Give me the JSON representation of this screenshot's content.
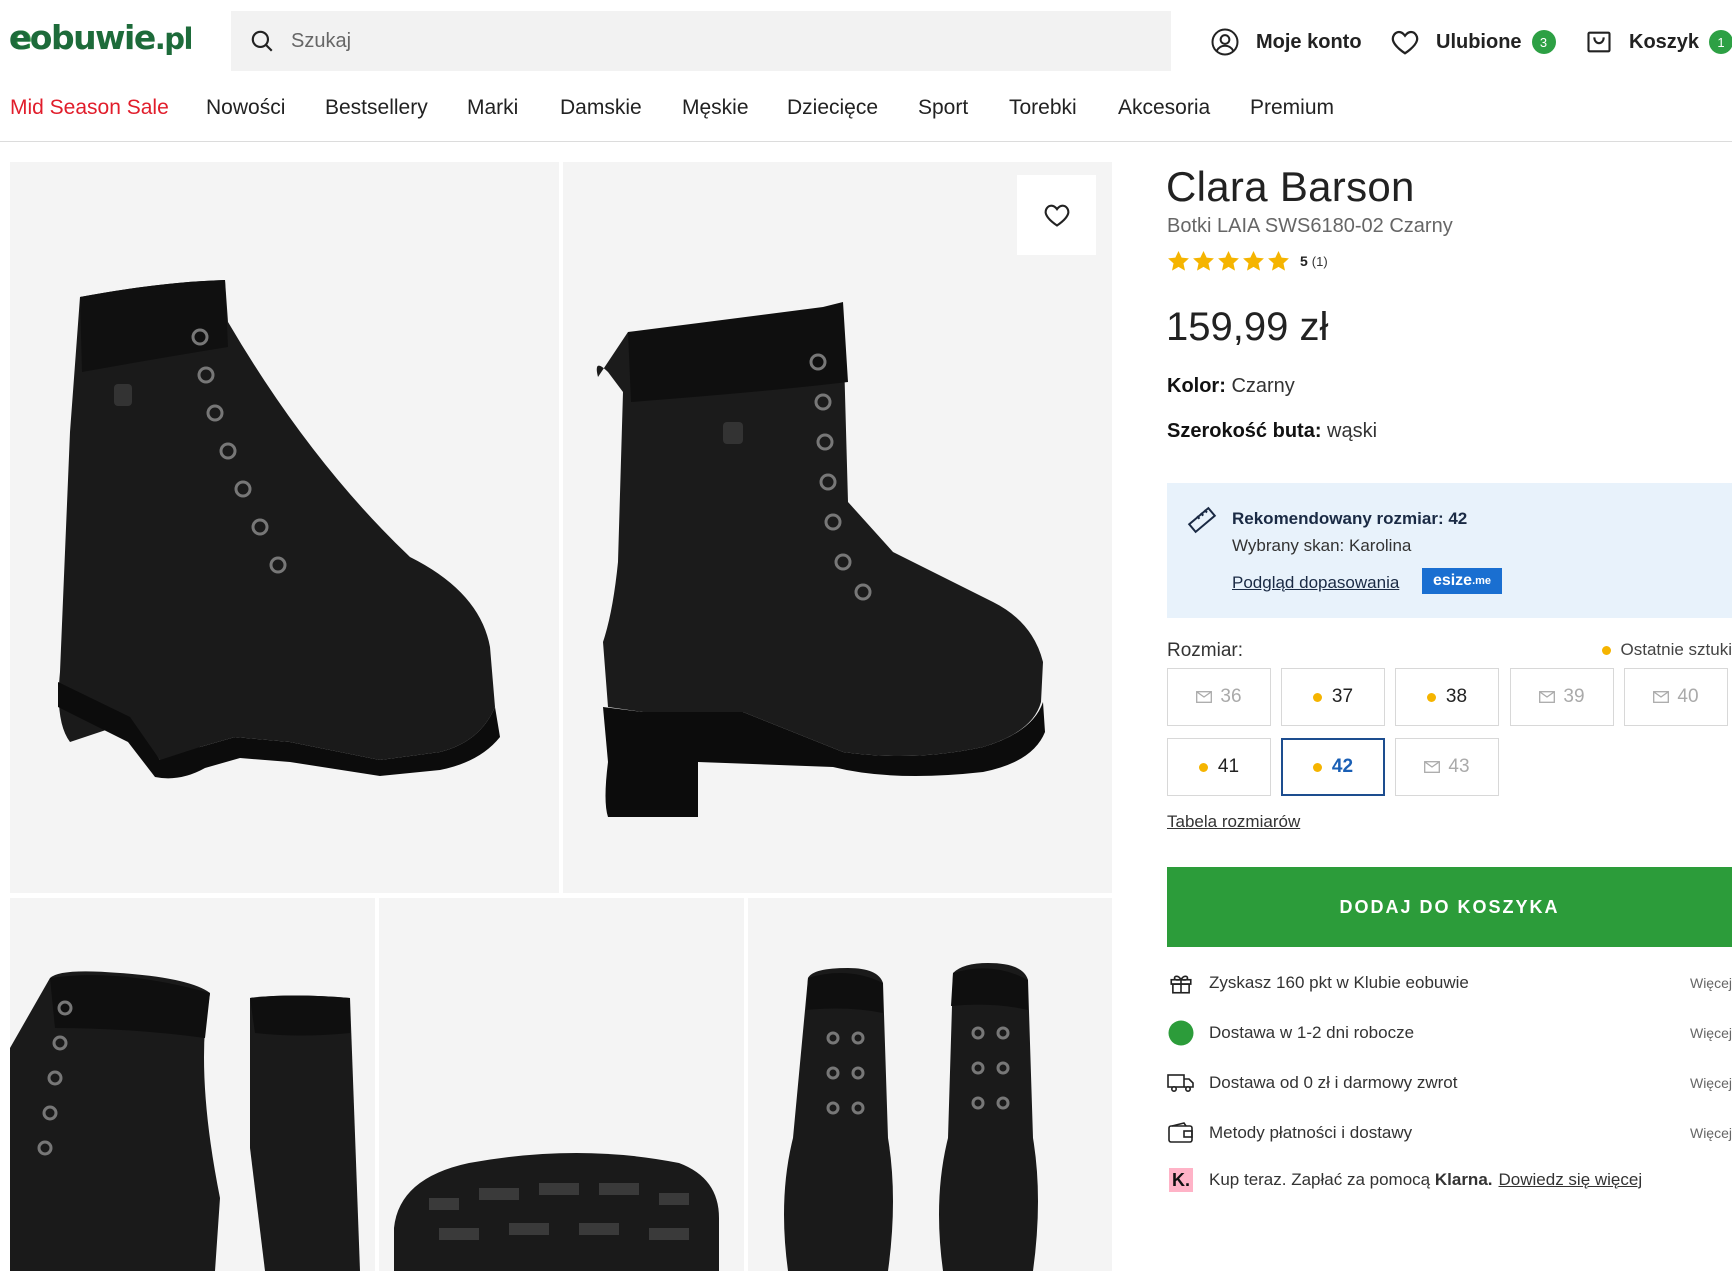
{
  "header": {
    "logo_main": "eobuwie",
    "logo_tld": ".pl",
    "search_placeholder": "Szukaj",
    "account_label": "Moje konto",
    "favorites_label": "Ulubione",
    "favorites_count": "3",
    "cart_label": "Koszyk",
    "cart_count": "1"
  },
  "nav": {
    "items": [
      "Mid Season Sale",
      "Nowości",
      "Bestsellery",
      "Marki",
      "Damskie",
      "Męskie",
      "Dziecięce",
      "Sport",
      "Torebki",
      "Akcesoria",
      "Premium"
    ]
  },
  "product": {
    "brand": "Clara Barson",
    "name": "Botki LAIA SWS6180-02 Czarny",
    "rating_value": "5",
    "rating_count": "(1)",
    "rating_stars": 5,
    "price": "159,99 zł",
    "color_label": "Kolor:",
    "color_value": "Czarny",
    "width_label": "Szerokość buta:",
    "width_value": "wąski"
  },
  "recommendation": {
    "title": "Rekomendowany rozmiar: 42",
    "scan": "Wybrany skan: Karolina",
    "link": "Podgląd dopasowania",
    "badge_main": "esize",
    "badge_suffix": ".me"
  },
  "sizes": {
    "label": "Rozmiar:",
    "last_items_label": "Ostatnie sztuki",
    "options": [
      {
        "size": "36",
        "status": "unavailable"
      },
      {
        "size": "37",
        "status": "last"
      },
      {
        "size": "38",
        "status": "last"
      },
      {
        "size": "39",
        "status": "unavailable"
      },
      {
        "size": "40",
        "status": "unavailable"
      },
      {
        "size": "41",
        "status": "last"
      },
      {
        "size": "42",
        "status": "selected"
      },
      {
        "size": "43",
        "status": "unavailable"
      }
    ],
    "table_link": "Tabela rozmiarów"
  },
  "cta": {
    "add_to_cart": "DODAJ DO KOSZYKA"
  },
  "info": {
    "points": "Zyskasz 160 pkt w Klubie eobuwie",
    "delivery_time": "Dostawa w 1-2 dni robocze",
    "delivery_cost": "Dostawa od 0 zł i darmowy zwrot",
    "payment": "Metody płatności i dostawy",
    "more": "Więcej",
    "klarna_prefix": "Kup teraz. Zapłać za pomocą",
    "klarna_brand": "Klarna.",
    "klarna_link": "Dowiedz się więcej",
    "klarna_logo": "K."
  },
  "colors": {
    "brand_green": "#2c9c3a",
    "sale_red": "#e11d2b",
    "last_items_dot": "#f5b400",
    "selected_size": "#1d4d8f",
    "rec_bg": "#e8f2fb"
  }
}
